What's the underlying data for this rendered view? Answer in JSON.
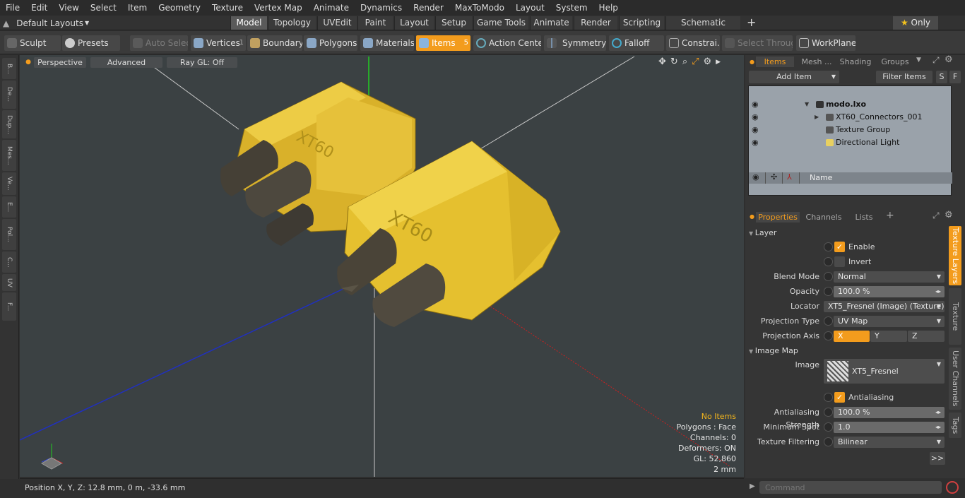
{
  "menu": [
    "File",
    "Edit",
    "View",
    "Select",
    "Item",
    "Geometry",
    "Texture",
    "Vertex Map",
    "Animate",
    "Dynamics",
    "Render",
    "MaxToModo",
    "Layout",
    "System",
    "Help"
  ],
  "layout_selector": "Default Layouts",
  "mode_tabs": [
    "Model",
    "Topology",
    "UVEdit",
    "Paint",
    "Layout",
    "Setup",
    "Game Tools",
    "Animate",
    "Render",
    "Scripting",
    "Schematic Fusion"
  ],
  "only_label": "Only",
  "toolbar": {
    "sculpt": "Sculpt",
    "presets": "Presets",
    "auto_select": "Auto Select",
    "vertices": "Vertices",
    "vertices_count": "1",
    "boundary": "Boundary",
    "polygons": "Polygons",
    "materials": "Materials",
    "items": "Items",
    "items_count": "5",
    "action_center": "Action Center",
    "symmetry": "Symmetry",
    "falloff": "Falloff",
    "constraints": "Constrai...",
    "select_through": "Select Through",
    "workplane": "WorkPlane"
  },
  "left_tabs": [
    "B...",
    "De...",
    "Dup...",
    "Mes...",
    "Ve...",
    "E...",
    "Pol...",
    "C...",
    "UV",
    "F..."
  ],
  "viewport": {
    "view": "Perspective",
    "shading": "Advanced",
    "raygl": "Ray GL: Off",
    "stats": {
      "no_items": "No Items",
      "polygons": "Polygons : Face",
      "channels": "Channels: 0",
      "deformers": "Deformers: ON",
      "gl": "GL: 52,860",
      "scale": "2 mm"
    },
    "model_label": "XT60"
  },
  "status": {
    "position": "Position X, Y, Z:   12.8 mm, 0 m, -33.6 mm"
  },
  "items_panel": {
    "tabs": [
      "Items",
      "Mesh ...",
      "Shading",
      "Groups"
    ],
    "add_item": "Add Item",
    "filter": "Filter Items",
    "s": "S",
    "f": "F",
    "col_name": "Name",
    "rows": [
      {
        "name": "modo.lxo",
        "bold": true
      },
      {
        "name": "XT60_Connectors_001"
      },
      {
        "name": "Texture Group"
      },
      {
        "name": "Directional Light"
      }
    ]
  },
  "props_panel": {
    "tabs": [
      "Properties",
      "Channels",
      "Lists"
    ],
    "layer_section": "Layer",
    "enable": "Enable",
    "invert": "Invert",
    "blend_mode_label": "Blend Mode",
    "blend_mode": "Normal",
    "opacity_label": "Opacity",
    "opacity": "100.0 %",
    "locator_label": "Locator",
    "locator": "XT5_Fresnel (Image) (Texture)",
    "proj_type_label": "Projection Type",
    "proj_type": "UV Map",
    "proj_axis_label": "Projection Axis",
    "axis": [
      "X",
      "Y",
      "Z"
    ],
    "image_map_section": "Image Map",
    "image_label": "Image",
    "image": "XT5_Fresnel",
    "antialiasing": "Antialiasing",
    "aa_strength_label": "Antialiasing Strength",
    "aa_strength": "100.0 %",
    "min_spot_label": "Minimum Spot",
    "min_spot": "1.0",
    "tex_filter_label": "Texture Filtering",
    "tex_filter": "Bilinear",
    "more": ">>"
  },
  "side_tabs": [
    "Texture Layers",
    "Texture Locator",
    "User Channels",
    "Tags"
  ],
  "command_placeholder": "Command",
  "colors": {
    "accent": "#f39c1d",
    "viewport": "#3b4143",
    "yellow": "#e8c12a"
  }
}
